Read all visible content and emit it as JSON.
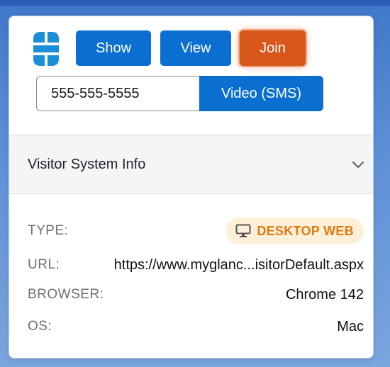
{
  "toolbar": {
    "show_label": "Show",
    "view_label": "View",
    "join_label": "Join"
  },
  "phone": {
    "value": "555-555-5555",
    "video_label": "Video (SMS)"
  },
  "section": {
    "title": "Visitor System Info"
  },
  "info": {
    "type_label": "TYPE:",
    "type_value": "DESKTOP WEB",
    "url_label": "URL:",
    "url_value": "https://www.myglanc...isitorDefault.aspx",
    "browser_label": "BROWSER:",
    "browser_value": "Chrome 142",
    "os_label": "OS:",
    "os_value": "Mac"
  },
  "icons": {
    "logo": "glance-logo",
    "chevron": "chevron-down-icon",
    "desktop": "desktop-monitor-icon"
  },
  "colors": {
    "primary": "#0a6fd1",
    "join": "#d8571a",
    "badge_bg": "#fdf0d8",
    "badge_text": "#e07b14"
  }
}
